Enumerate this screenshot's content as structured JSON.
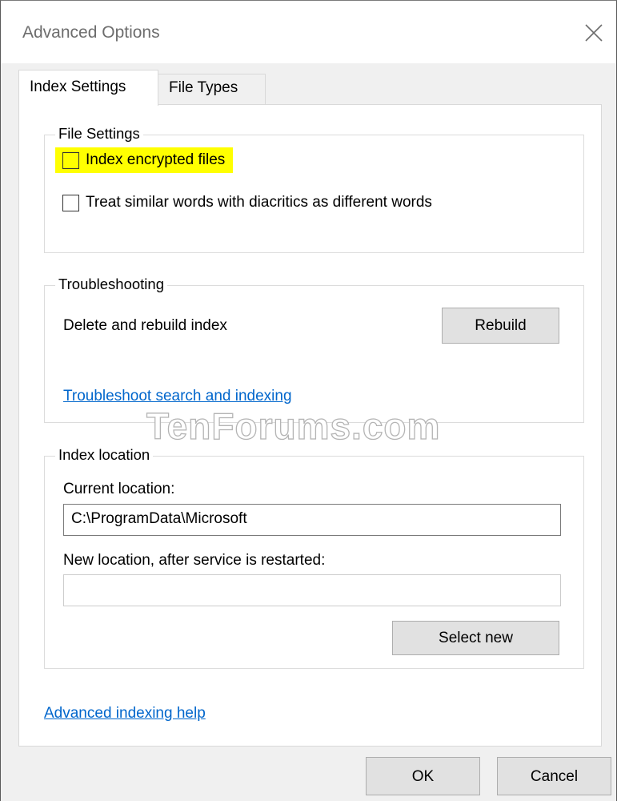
{
  "window": {
    "title": "Advanced Options",
    "close_icon": "close-icon"
  },
  "tabs": [
    {
      "label": "Index Settings",
      "active": true
    },
    {
      "label": "File Types",
      "active": false
    }
  ],
  "file_settings": {
    "title": "File Settings",
    "options": [
      {
        "label": "Index encrypted files",
        "checked": false,
        "highlighted": true
      },
      {
        "label": "Treat similar words with diacritics as different words",
        "checked": false,
        "highlighted": false
      }
    ]
  },
  "troubleshooting": {
    "title": "Troubleshooting",
    "rebuild_text": "Delete and rebuild index",
    "rebuild_button": "Rebuild",
    "troubleshoot_link": "Troubleshoot search and indexing"
  },
  "index_location": {
    "title": "Index location",
    "current_label": "Current location:",
    "current_value": "C:\\ProgramData\\Microsoft",
    "new_label": "New location, after service is restarted:",
    "new_value": "",
    "select_button": "Select new"
  },
  "help_link": "Advanced indexing help",
  "watermark": "TenForums.com",
  "footer": {
    "ok": "OK",
    "cancel": "Cancel"
  },
  "colors": {
    "highlight": "#ffff00",
    "link": "#0066cc"
  }
}
